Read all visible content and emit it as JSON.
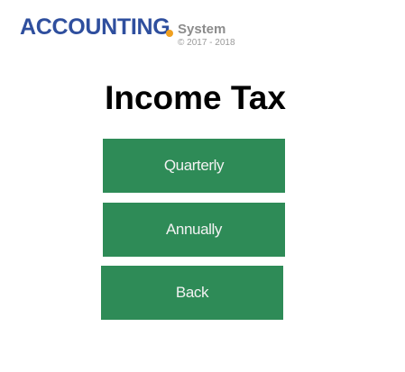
{
  "logo": {
    "word": "ACCOUNTING",
    "subword": "System",
    "copyright": "© 2017 - 2018",
    "dot_color": "#f0a020",
    "brand_color": "#2f4f9e"
  },
  "page": {
    "title": "Income Tax"
  },
  "menu": {
    "quarterly_label": "Quarterly",
    "annually_label": "Annually",
    "back_label": "Back",
    "button_color": "#2e8b57"
  }
}
